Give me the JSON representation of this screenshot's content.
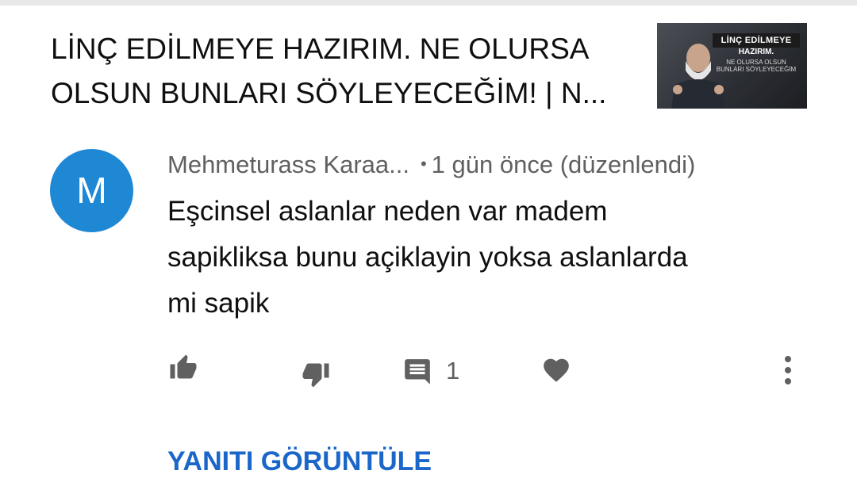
{
  "video": {
    "title_line1": "LİNÇ EDİLMEYE HAZIRIM. NE OLURSA",
    "title_line2": "OLSUN BUNLARI SÖYLEYECEĞİM! | N...",
    "thumbnail": {
      "tag": "LİNÇ EDİLMEYE",
      "line1": "HAZIRIM.",
      "line2": "NE OLURSA OLSUN BUNLARI SÖYLEYECEĞİM"
    }
  },
  "comment": {
    "avatar_letter": "M",
    "author": "Mehmeturass Karaa...",
    "separator": "•",
    "time": "1 gün önce (düzenlendi)",
    "text_line1": "Eşcinsel aslanlar neden var madem",
    "text_line2": "sapikliksa bunu açiklayin yoksa aslanlarda",
    "text_line3": "mi sapik",
    "reply_count": "1"
  },
  "actions": {
    "icons": [
      "thumbs-up-icon",
      "thumbs-down-icon",
      "reply-icon",
      "heart-icon",
      "more-vert-icon"
    ],
    "view_replies_label": "YANITI GÖRÜNTÜLE"
  },
  "colors": {
    "avatar": "#1e88d4",
    "link": "#1a66c9",
    "secondary_text": "#606060",
    "icon": "#606060"
  }
}
